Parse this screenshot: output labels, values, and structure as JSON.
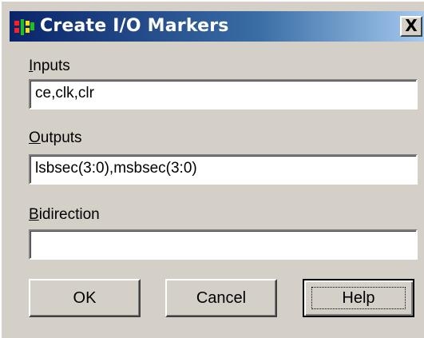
{
  "window": {
    "title": "Create I/O Markers",
    "close_label": "X",
    "icon": "app-icon"
  },
  "fields": {
    "inputs": {
      "mnemonic": "I",
      "label_rest": "nputs",
      "value": "ce,clk,clr"
    },
    "outputs": {
      "mnemonic": "O",
      "label_rest": "utputs",
      "value": "lsbsec(3:0),msbsec(3:0)"
    },
    "bidirection": {
      "mnemonic": "B",
      "label_rest": "idirection",
      "value": ""
    }
  },
  "buttons": {
    "ok": "OK",
    "cancel": "Cancel",
    "help": "Help"
  },
  "colors": {
    "dialog_background": "#d4d0c8",
    "titlebar_start": "#0a246a",
    "titlebar_end": "#a6caf0"
  }
}
